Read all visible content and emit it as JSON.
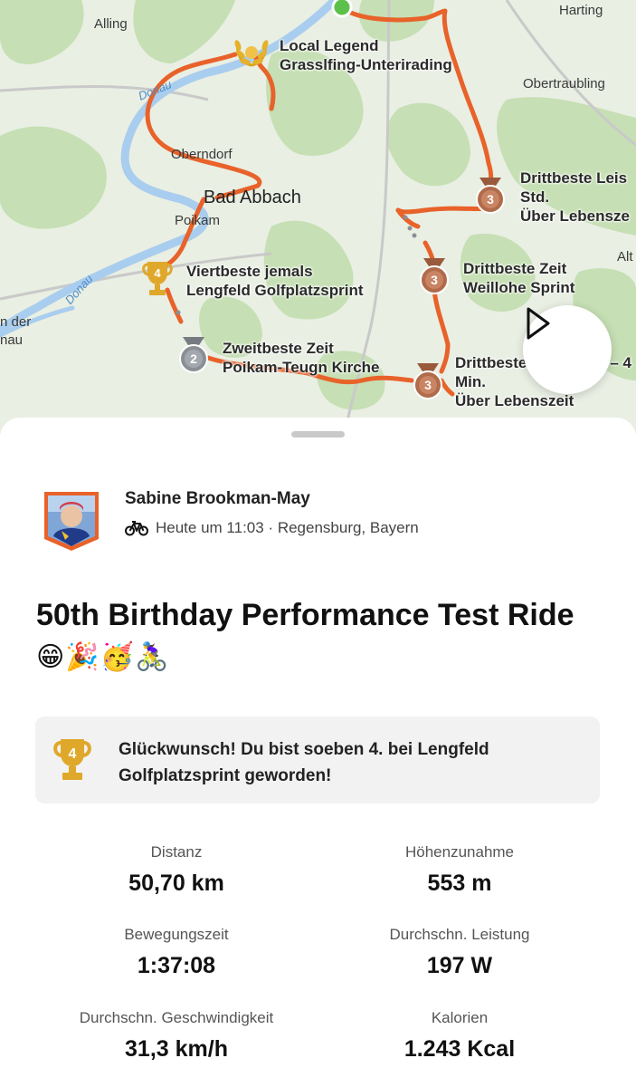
{
  "map": {
    "places": {
      "alling": "Alling",
      "harting": "Harting",
      "obertraubling": "Obertraubling",
      "oberndorf": "Oberndorf",
      "bad_abbach": "Bad Abbach",
      "poikam": "Poikam",
      "alt": "Alt",
      "an_der": "n der",
      "donau_edge": "nau"
    },
    "rivers": {
      "upper": "Donau",
      "lower": "Donau"
    },
    "segments": [
      {
        "line1": "Local Legend",
        "line2": "Grasslfing-Unterirading",
        "badge": "local-legend"
      },
      {
        "line1": "Drittbeste Leis",
        "line2": "Std.",
        "line3": "Über Lebensze",
        "badge": "3"
      },
      {
        "line1": "Drittbeste Zeit",
        "line2": "Weillohe Sprint",
        "badge": "3"
      },
      {
        "line1": "Viertbeste jemals",
        "line2": "Lengfeld Golfplatzsprint",
        "badge": "4"
      },
      {
        "line1": "Zweitbeste Zeit",
        "line2": "Poikam-Teugn Kirche",
        "badge": "2"
      },
      {
        "line1": "Drittbeste",
        "line1b": "– 4",
        "line2": "Min.",
        "line3": "Über Lebenszeit",
        "badge": "3"
      }
    ]
  },
  "activity": {
    "athlete_name": "Sabine Brookman-May",
    "meta": "Heute um 11:03 · Regensburg, Bayern",
    "sport_icon": "bicycle-icon",
    "title": "50th Birthday Performance Test Ride",
    "emojis": [
      "😁",
      "🎉",
      "🥳",
      "🚴‍♀️"
    ],
    "achievement": {
      "rank": "4",
      "text": "Glückwunsch! Du bist soeben 4. bei Lengfeld Golfplatzsprint geworden!"
    },
    "stats": [
      {
        "label": "Distanz",
        "value": "50,70 km"
      },
      {
        "label": "Höhenzunahme",
        "value": "553 m"
      },
      {
        "label": "Bewegungszeit",
        "value": "1:37:08"
      },
      {
        "label": "Durchschn. Leistung",
        "value": "197 W"
      },
      {
        "label": "Durchschn. Geschwindigkeit",
        "value": "31,3 km/h"
      },
      {
        "label": "Kalorien",
        "value": "1.243 Kcal"
      }
    ]
  },
  "colors": {
    "route": "#e8622a",
    "gold": "#d9a21b",
    "silver": "#8a8f96",
    "bronze": "#b06b4a",
    "map_green": "#c6dfb4",
    "map_base": "#e9efe3",
    "river": "#a9cdee"
  }
}
